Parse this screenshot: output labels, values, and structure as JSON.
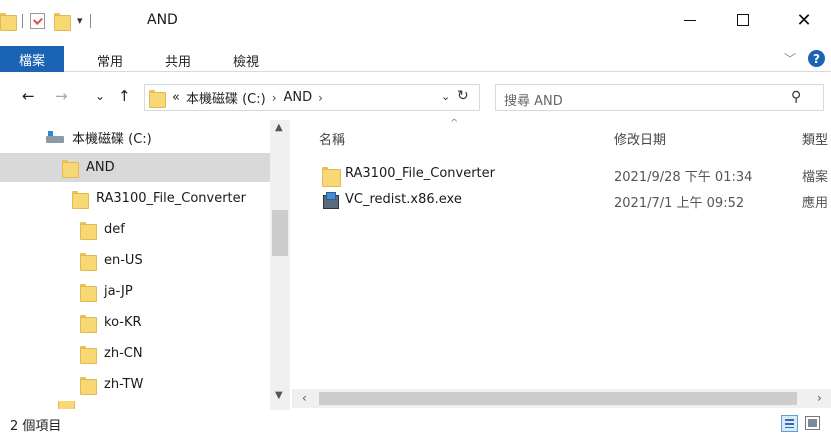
{
  "window": {
    "title": "AND",
    "minimize_glyph": "—",
    "close_glyph": "✕"
  },
  "quick_access": {
    "dropdown_glyph": "▾",
    "icons": [
      "folder-icon",
      "properties-check-icon",
      "new-folder-icon"
    ]
  },
  "ribbon": {
    "file_tab": "檔案",
    "tabs": [
      "常用",
      "共用",
      "檢視"
    ],
    "expand_glyph": "﹀",
    "help_glyph": "?"
  },
  "nav": {
    "back": "←",
    "forward": "→",
    "recent": "⌄",
    "up": "↑",
    "address": {
      "overflow": "«",
      "crumbs": [
        "本機磁碟 (C:)",
        "AND"
      ],
      "separator": "›",
      "dropdown": "⌄",
      "refresh": "↻"
    },
    "search": {
      "placeholder": "搜尋 AND",
      "icon": "⚲"
    }
  },
  "tree": {
    "items": [
      {
        "label": "本機磁碟 (C:)",
        "icon": "drive-icon",
        "selected": false
      },
      {
        "label": "AND",
        "icon": "folder-icon",
        "selected": true
      },
      {
        "label": "RA3100_File_Converter",
        "icon": "folder-icon",
        "selected": false
      },
      {
        "label": "def",
        "icon": "folder-icon",
        "selected": false
      },
      {
        "label": "en-US",
        "icon": "folder-icon",
        "selected": false
      },
      {
        "label": "ja-JP",
        "icon": "folder-icon",
        "selected": false
      },
      {
        "label": "ko-KR",
        "icon": "folder-icon",
        "selected": false
      },
      {
        "label": "zh-CN",
        "icon": "folder-icon",
        "selected": false
      },
      {
        "label": "zh-TW",
        "icon": "folder-icon",
        "selected": false
      }
    ],
    "scroll_up": "▲",
    "scroll_down": "▼"
  },
  "content": {
    "sort_caret": "^",
    "columns": {
      "name": "名稱",
      "date": "修改日期",
      "type": "類型"
    },
    "files": [
      {
        "name": "RA3100_File_Converter",
        "date": "2021/9/28 下午 01:34",
        "type": "檔案",
        "icon": "folder-icon"
      },
      {
        "name": "VC_redist.x86.exe",
        "date": "2021/7/1 上午 09:52",
        "type": "應用",
        "icon": "installer-exe-icon"
      }
    ],
    "scroll_left": "‹",
    "scroll_right": "›"
  },
  "status": {
    "item_count": "2 個項目"
  },
  "colors": {
    "accent": "#1a64b3",
    "selected_row": "#d9d9d9",
    "folder": "#f8d775"
  }
}
